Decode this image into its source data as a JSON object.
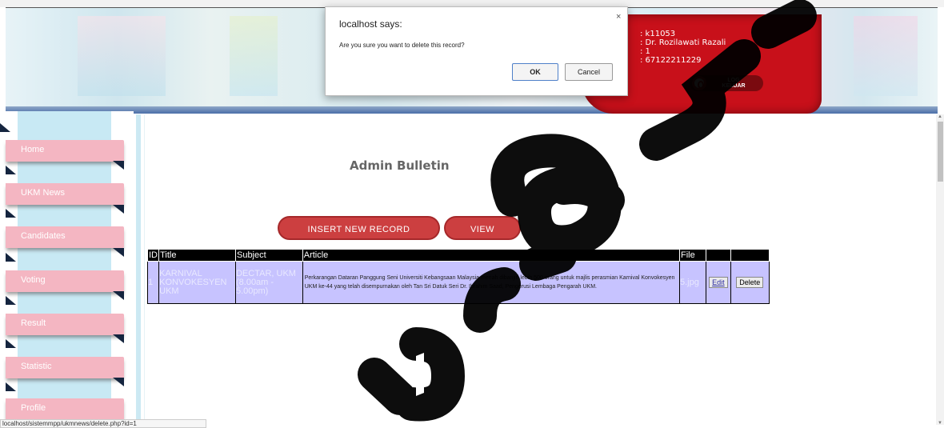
{
  "header": {
    "user": {
      "id": ": k11053",
      "name": ": Dr. Rozilawati Razali",
      "level": ": 1",
      "phone": ": 67122211229"
    },
    "logout_label_1": "LOG",
    "logout_label_2": "KELUAR"
  },
  "sidebar": {
    "items": [
      {
        "label": "Home"
      },
      {
        "label": "UKM News"
      },
      {
        "label": "Candidates"
      },
      {
        "label": "Voting"
      },
      {
        "label": "Result"
      },
      {
        "label": "Statistic"
      },
      {
        "label": "Profile"
      }
    ]
  },
  "main": {
    "title": "Admin Bulletin",
    "insert_button": "INSERT NEW RECORD",
    "view_button": "VIEW",
    "table": {
      "headers": [
        "ID",
        "Title",
        "Subject",
        "Article",
        "File",
        "",
        ""
      ],
      "rows": [
        {
          "id": "1",
          "title": "KARNIVAL KONVOKESYEN UKM",
          "subject": "DECTAR, UKM (8.00am - 5.00pm)",
          "article": "Perkarangan Dataran Panggung Seni Universiti Kebangsaan Malaysia meriah dibanjiri lebih 500 orang untuk majlis perasmian Karnival Konvokesyen UKM ke-44 yang telah disempurnakan oleh Tan Sri Datuk Seri Dr. Ibrahim Saad, Pengerusi Lembaga Pengarah UKM.",
          "file": "5.jpg",
          "edit": "Edit",
          "delete": "Delete"
        }
      ]
    }
  },
  "dialog": {
    "title": "localhost says:",
    "message": "Are you sure you want to delete this record?",
    "ok": "OK",
    "cancel": "Cancel",
    "close": "×"
  },
  "statusbar": {
    "url": "localhost/sistemmpp/ukmnews/delete.php?id=1"
  },
  "colors": {
    "header_red": "#c8101a",
    "nav_pink": "#f4b6c2",
    "button_red": "#cc3f40",
    "table_row": "#c7c3ff"
  }
}
